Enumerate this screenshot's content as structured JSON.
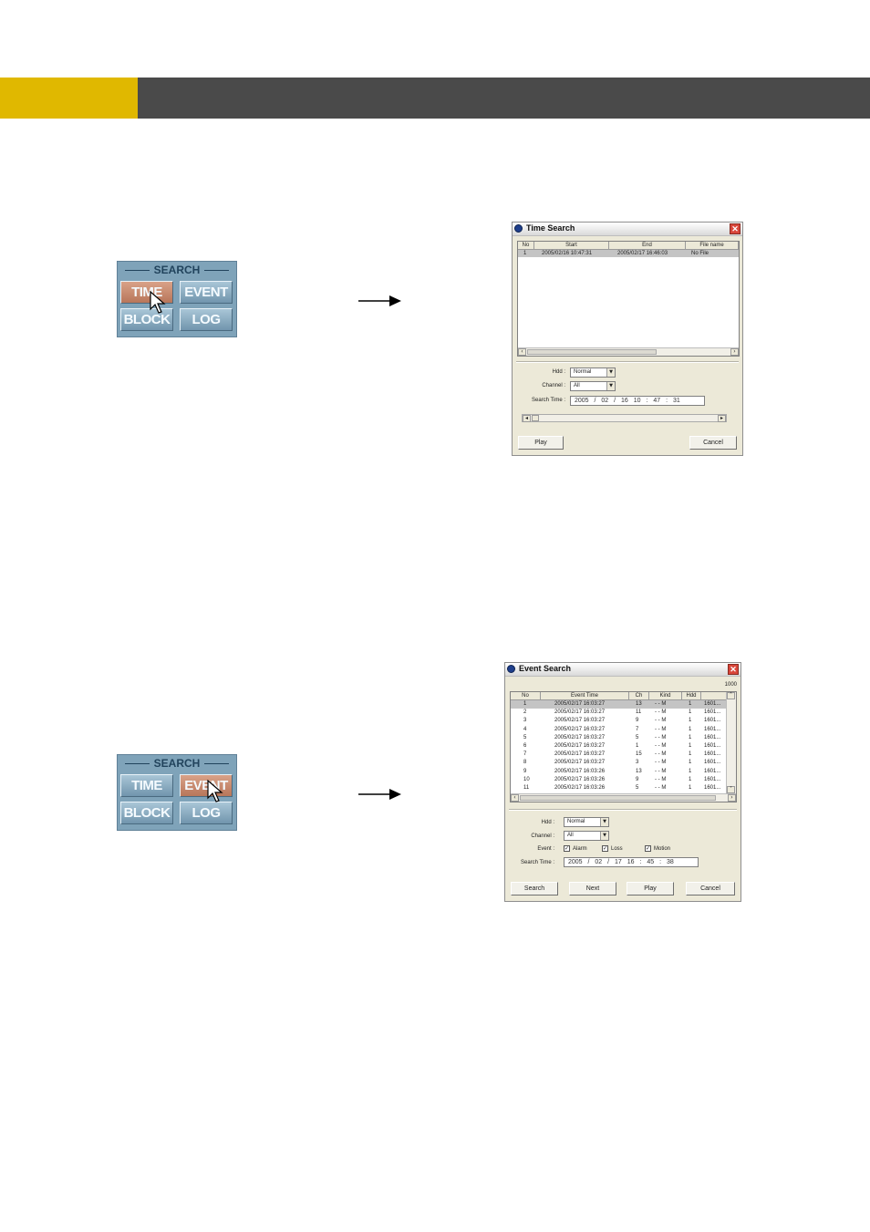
{
  "search_panel_1": {
    "title": "SEARCH",
    "time": "TIME",
    "event": "EVENT",
    "block": "BLOCK",
    "log": "LOG",
    "selected": "TIME"
  },
  "search_panel_2": {
    "title": "SEARCH",
    "time": "TIME",
    "event": "EVENT",
    "block": "BLOCK",
    "log": "LOG",
    "selected": "EVENT"
  },
  "time_search": {
    "title": "Time Search",
    "columns": [
      "No",
      "Start",
      "End",
      "File name"
    ],
    "rows": [
      {
        "no": "1",
        "start": "2005/02/16 10:47:31",
        "end": "2005/02/17 16:46:03",
        "file": "No File"
      }
    ],
    "hdd_label": "Hdd :",
    "hdd_value": "Normal",
    "channel_label": "Channel :",
    "channel_value": "All",
    "search_time_label": "Search Time :",
    "search_time_value": "2005 / 02 / 16   10 : 47 : 31",
    "play": "Play",
    "cancel": "Cancel"
  },
  "event_search": {
    "title": "Event Search",
    "count": "1000",
    "columns": [
      "No",
      "Event Time",
      "Ch",
      "Kind",
      "Hdd",
      ""
    ],
    "rows": [
      {
        "no": "1",
        "time": "2005/02/17 16:03:27",
        "ch": "13",
        "kind": "- - M",
        "hdd": "1",
        "file": "1601..."
      },
      {
        "no": "2",
        "time": "2005/02/17 16:03:27",
        "ch": "11",
        "kind": "- - M",
        "hdd": "1",
        "file": "1601..."
      },
      {
        "no": "3",
        "time": "2005/02/17 16:03:27",
        "ch": "9",
        "kind": "- - M",
        "hdd": "1",
        "file": "1601..."
      },
      {
        "no": "4",
        "time": "2005/02/17 16:03:27",
        "ch": "7",
        "kind": "- - M",
        "hdd": "1",
        "file": "1601..."
      },
      {
        "no": "5",
        "time": "2005/02/17 16:03:27",
        "ch": "5",
        "kind": "- - M",
        "hdd": "1",
        "file": "1601..."
      },
      {
        "no": "6",
        "time": "2005/02/17 16:03:27",
        "ch": "1",
        "kind": "- - M",
        "hdd": "1",
        "file": "1601..."
      },
      {
        "no": "7",
        "time": "2005/02/17 16:03:27",
        "ch": "15",
        "kind": "- - M",
        "hdd": "1",
        "file": "1601..."
      },
      {
        "no": "8",
        "time": "2005/02/17 16:03:27",
        "ch": "3",
        "kind": "- - M",
        "hdd": "1",
        "file": "1601..."
      },
      {
        "no": "9",
        "time": "2005/02/17 16:03:26",
        "ch": "13",
        "kind": "- - M",
        "hdd": "1",
        "file": "1601..."
      },
      {
        "no": "10",
        "time": "2005/02/17 16:03:26",
        "ch": "9",
        "kind": "- - M",
        "hdd": "1",
        "file": "1601..."
      },
      {
        "no": "11",
        "time": "2005/02/17 16:03:26",
        "ch": "5",
        "kind": "- - M",
        "hdd": "1",
        "file": "1601..."
      }
    ],
    "hdd_label": "Hdd :",
    "hdd_value": "Normal",
    "channel_label": "Channel :",
    "channel_value": "All",
    "event_label": "Event :",
    "alarm": "Alarm",
    "loss": "Loss",
    "motion": "Motion",
    "search_time_label": "Search Time :",
    "search_time_value": "2005 / 02 / 17   16 : 45 : 38",
    "search": "Search",
    "next": "Next",
    "play": "Play",
    "cancel": "Cancel"
  }
}
